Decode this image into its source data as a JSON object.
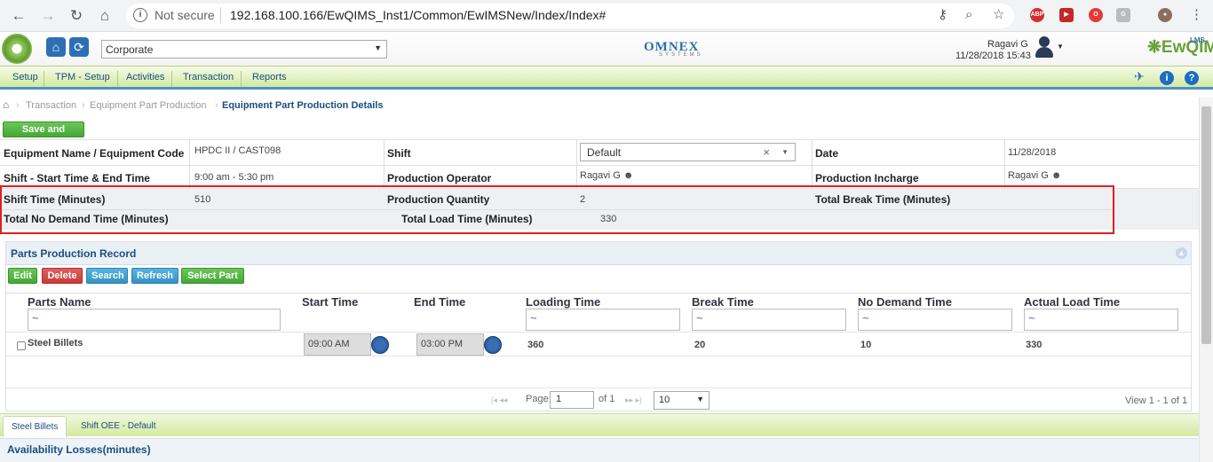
{
  "browser": {
    "not_secure": "Not secure",
    "url": "192.168.100.166/EwQIMS_Inst1/Common/EwIMSNew/Index/Index#",
    "ext_abp": "ABP"
  },
  "header": {
    "org_select": "Corporate",
    "brand": "OMNEX",
    "brand_sub": "SYSTEMS",
    "user_name": "Ragavi G",
    "datetime": "11/28/2018 15:43",
    "product": "EwQIMS",
    "product_sup": "LMS"
  },
  "menu": {
    "items": [
      "Setup",
      "TPM - Setup",
      "Activities",
      "Transaction",
      "Reports"
    ]
  },
  "breadcrumb": {
    "items": [
      "Transaction",
      "Equipment Part Production",
      "Equipment Part Production Details"
    ]
  },
  "actions": {
    "save_submit": "Save and Submit"
  },
  "form": {
    "equipment_label": "Equipment Name / Equipment Code",
    "equipment_value": "HPDC II / CAST098",
    "shift_label": "Shift",
    "shift_value": "Default",
    "date_label": "Date",
    "date_value": "11/28/2018",
    "shift_time_label": "Shift - Start Time & End Time",
    "shift_time_value": "9:00 am - 5:30 pm",
    "operator_label": "Production Operator",
    "operator_value": "Ragavi G",
    "incharge_label": "Production Incharge",
    "incharge_value": "Ragavi G",
    "shift_minutes_label": "Shift Time (Minutes)",
    "shift_minutes_value": "510",
    "quantity_label": "Production Quantity",
    "quantity_value": "2",
    "break_label": "Total Break Time (Minutes)",
    "break_value": "",
    "no_demand_label": "Total No Demand Time (Minutes)",
    "no_demand_value": "",
    "load_label": "Total Load Time (Minutes)",
    "load_value": "330"
  },
  "parts_panel": {
    "title": "Parts Production Record",
    "buttons": {
      "edit": "Edit",
      "delete": "Delete",
      "search": "Search",
      "refresh": "Refresh",
      "select_part": "Select Part"
    },
    "columns": [
      "Parts Name",
      "Start Time",
      "End Time",
      "Loading Time",
      "Break Time",
      "No Demand Time",
      "Actual Load Time"
    ],
    "filter_symbol": "~",
    "rows": [
      {
        "part": "Steel Billets",
        "start": "09:00 AM",
        "end": "03:00 PM",
        "loading": "360",
        "break": "20",
        "no_demand": "10",
        "actual_load": "330"
      }
    ],
    "pager": {
      "page_label": "Page",
      "page": "1",
      "of_label": "of 1",
      "page_size": "10",
      "view": "View 1 - 1 of 1"
    }
  },
  "tabs": {
    "items": [
      "Steel Billets",
      "Shift OEE - Default"
    ]
  },
  "section": {
    "availability": "Availability Losses(minutes)"
  },
  "colors": {
    "accent": "#4d90cc",
    "menu_green": "#d3ea9f",
    "highlight": "#e02020",
    "button_green": "#44a834",
    "button_red": "#c93a3a",
    "button_blue": "#3592c4"
  }
}
